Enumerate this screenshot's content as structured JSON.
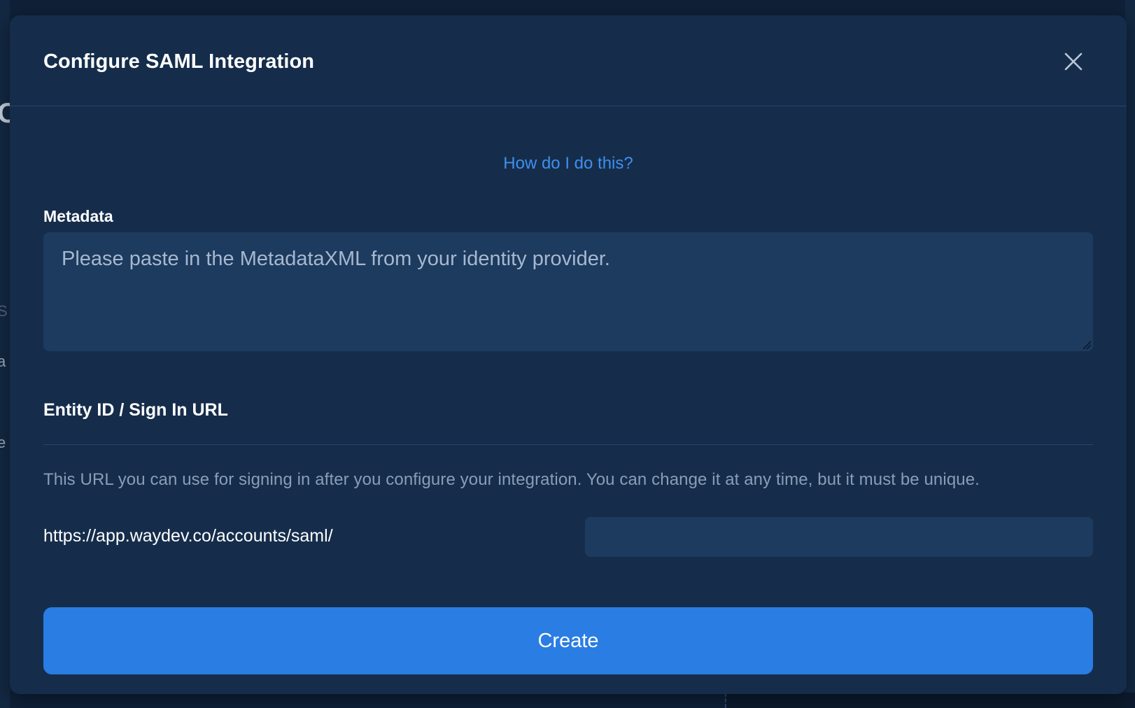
{
  "modal": {
    "title": "Configure SAML Integration",
    "help_link": "How do I do this?",
    "metadata": {
      "label": "Metadata",
      "placeholder": "Please paste in the MetadataXML from your identity provider.",
      "value": ""
    },
    "entity": {
      "title": "Entity ID / Sign In URL",
      "description": "This URL you can use for signing in after you configure your integration. You can change it at any time, but it must be unique.",
      "url_prefix": "https://app.waydev.co/accounts/saml/",
      "slug_value": ""
    },
    "create_label": "Create"
  },
  "background": {
    "fragments": [
      "O",
      "S",
      "a",
      "e"
    ]
  },
  "colors": {
    "modal_bg": "#152d4b",
    "input_bg": "#1d3a5f",
    "accent": "#2a7de3",
    "link": "#3f8fee",
    "muted_text": "#8a9db6"
  },
  "icons": {
    "close": "close-icon",
    "resize": "resize-handle-icon"
  }
}
